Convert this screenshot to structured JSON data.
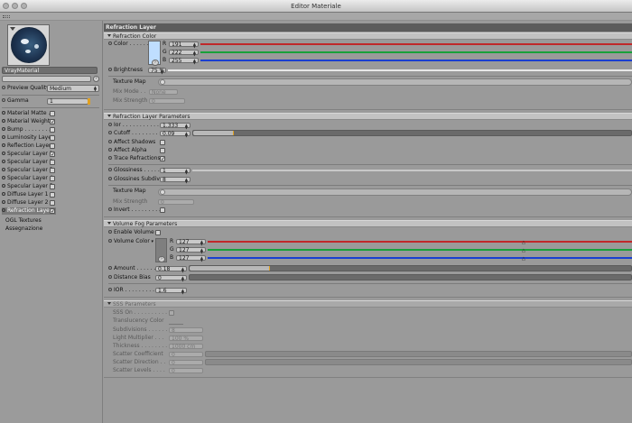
{
  "window": {
    "title": "Editor Materiale"
  },
  "sidebar": {
    "material_name": "VrayMaterial",
    "preview_quality_label": "Preview Quality",
    "preview_quality_value": "Medium",
    "gamma_label": "Gamma",
    "gamma_value": "1",
    "items": [
      {
        "label": "Material Matte . .",
        "checked": false
      },
      {
        "label": "Material Weight",
        "checked": true
      },
      {
        "label": "Bump . . . . . . . .",
        "checked": false
      },
      {
        "label": "Luminosity Layer",
        "checked": false
      },
      {
        "label": "Reflection Layer",
        "checked": false
      },
      {
        "label": "Specular Layer 1",
        "checked": true
      },
      {
        "label": "Specular Layer 2",
        "checked": false
      },
      {
        "label": "Specular Layer 3",
        "checked": false
      },
      {
        "label": "Specular Layer 4",
        "checked": false
      },
      {
        "label": "Specular Layer 5",
        "checked": false
      },
      {
        "label": "Diffuse Layer 1 .",
        "checked": false
      },
      {
        "label": "Diffuse Layer 2 .",
        "checked": false
      },
      {
        "label": "Refraction Layer",
        "checked": true
      }
    ],
    "extra": [
      "OGL Textures",
      "Assegnazione"
    ]
  },
  "main": {
    "layer_title": "Refraction Layer",
    "refraction_color": {
      "section": "Refraction Color",
      "color_label": "Color . . . . . .",
      "r_label": "R",
      "r_value": "191",
      "g_label": "G",
      "g_value": "222",
      "b_label": "B",
      "b_value": "255",
      "swatch": "#bfdeff",
      "brightness_label": "Brightness",
      "brightness_value": "75 %",
      "texture_map_label": "Texture Map",
      "mix_mode_label": "Mix Mode . .",
      "mix_mode_value": "None",
      "mix_strength_label": "Mix Strength",
      "mix_strength_value": "0"
    },
    "refraction_params": {
      "section": "Refraction Layer Parameters",
      "ior_label": "Ior . . . . . . . . . . . . .",
      "ior_value": "1.333",
      "cutoff_label": "Cutoff . . . . . . . . . .",
      "cutoff_value": "0.09",
      "cutoff_fraction": 0.09,
      "affect_shadows_label": "Affect Shadows",
      "affect_alpha_label": "Affect Alpha",
      "trace_refractions_label": "Trace Refractions",
      "glossiness_label": "Glossiness . . . . . . .",
      "glossiness_value": "1",
      "glossiness_subdivs_label": "Glossines Subdivs",
      "glossiness_subdivs_value": "8",
      "texture_map_label": "Texture Map",
      "mix_strength_label": "Mix Strength",
      "mix_strength_value": "0",
      "invert_label": "Invert . . . . . . . . . ."
    },
    "volume_fog": {
      "section": "Volume Fog Parameters",
      "enable_label": "Enable Volume",
      "color_label": "Volume Color",
      "r_label": "R",
      "r_value": "127",
      "g_label": "G",
      "g_value": "127",
      "b_label": "B",
      "b_value": "127",
      "swatch": "#7f7f7f",
      "amount_label": "Amount . . . . . . . . .",
      "amount_value": "0.18",
      "amount_fraction": 0.18,
      "distance_bias_label": "Distance Bias",
      "distance_bias_value": "0",
      "ior_label": "IOR . . . . . . . . . . . . .",
      "ior_value": "1.6"
    },
    "sss": {
      "section": "SSS Parameters",
      "sss_on_label": "SSS On . . . . . . . . . . .",
      "translucency_label": "Translucency Color",
      "subdivisions_label": "Subdivisions . . . . . .",
      "subdivisions_value": "8",
      "light_multiplier_label": "Light Multiplier . . .",
      "light_multiplier_value": "100 %",
      "thickness_label": "Thickness . . . . . . . . .",
      "thickness_value": "1000 cm",
      "scatter_coeff_label": "Scatter Coefficient",
      "scatter_coeff_value": "0",
      "scatter_dir_label": "Scatter Direction . .",
      "scatter_dir_value": "0",
      "scatter_levels_label": "Scatter Levels . . . .",
      "scatter_levels_value": "0"
    }
  },
  "colors": {
    "red": "#c0282a",
    "green": "#18a03a",
    "blue": "#1a3fd0"
  }
}
